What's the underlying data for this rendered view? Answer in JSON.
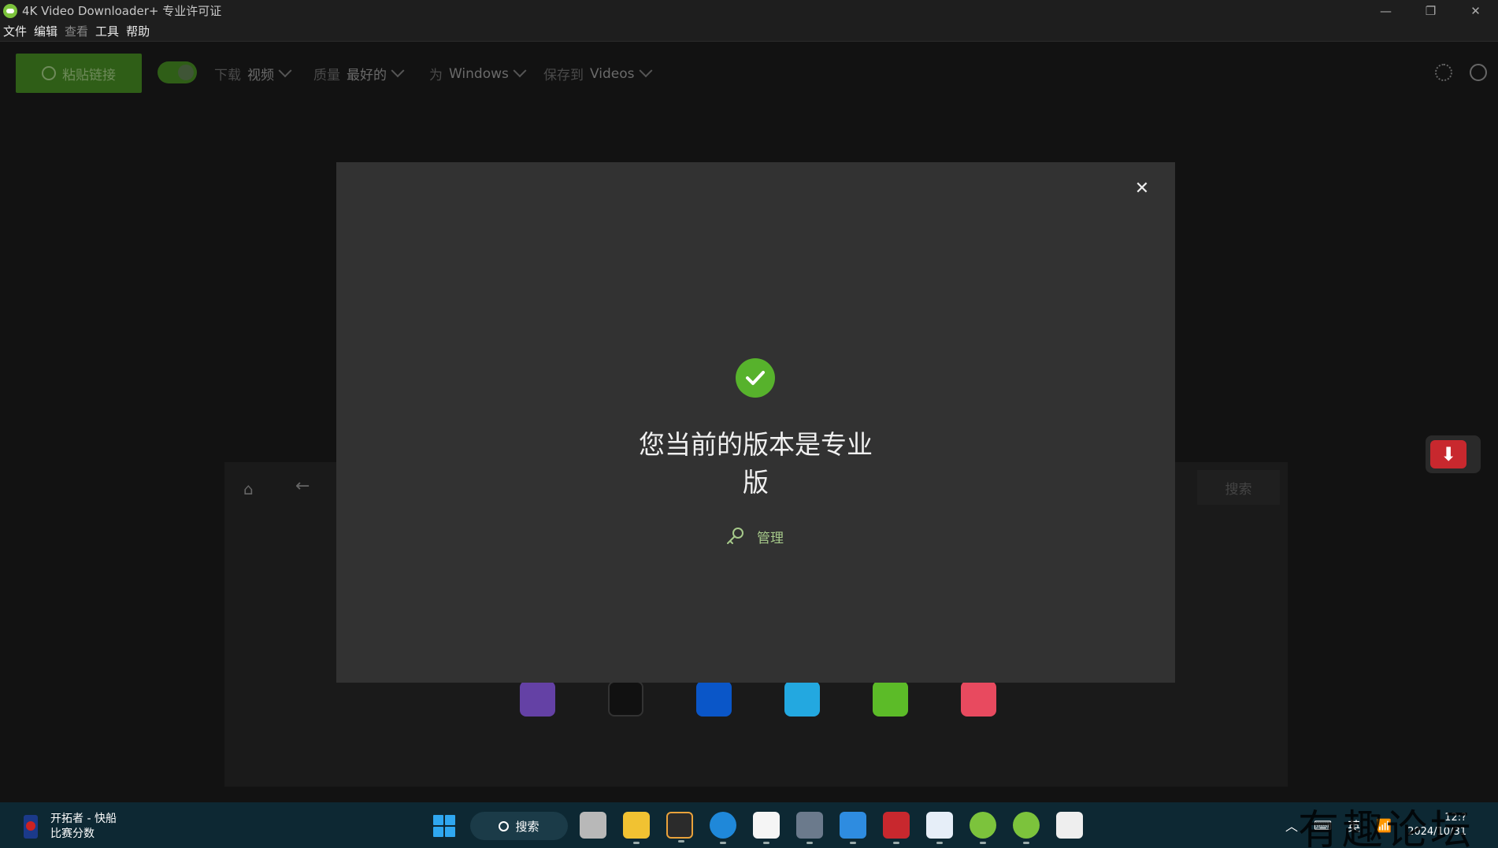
{
  "window": {
    "title": "4K Video Downloader+ 专业许可证",
    "controls": {
      "minimize": "—",
      "restore": "❐",
      "close": "✕"
    }
  },
  "menu": [
    "文件",
    "编辑",
    "查看",
    "工具",
    "帮助"
  ],
  "toolbar": {
    "paste_label": "粘贴链接",
    "download": {
      "key": "下载",
      "value": "视频"
    },
    "quality": {
      "key": "质量",
      "value": "最好的"
    },
    "platform": {
      "key": "为",
      "value": "Windows"
    },
    "save_to": {
      "key": "保存到",
      "value": "Videos"
    },
    "icons": [
      "settings-icon",
      "account-icon"
    ]
  },
  "browser": {
    "search_label": "搜索",
    "sites": [
      {
        "icon": "twitch-icon",
        "color": "#6441a5"
      },
      {
        "icon": "tv-icon",
        "color": "#111111"
      },
      {
        "icon": "dailymotion-icon",
        "color": "#0a56c8"
      },
      {
        "icon": "bilibili-icon",
        "color": "#23a8e0"
      },
      {
        "icon": "rumble-icon",
        "color": "#5cbb28"
      },
      {
        "icon": "likee-icon",
        "color": "#e84a5f"
      }
    ]
  },
  "modal": {
    "title": "您当前的版本是专业版",
    "manage_label": "管理",
    "close_icon": "✕",
    "accent": "#57b22c"
  },
  "taskbar": {
    "news_title": "开拓者 - 快船",
    "news_subtitle": "比赛分数",
    "search_label": "搜索",
    "ime": "英",
    "time": "12:?",
    "date": "2024/10/31",
    "watermark": "有趣论坛"
  }
}
